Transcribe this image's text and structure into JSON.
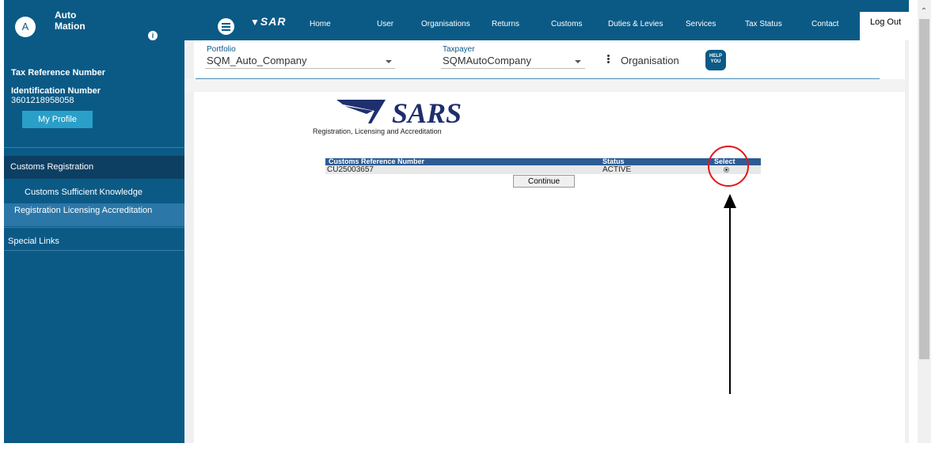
{
  "user": {
    "initial": "A",
    "first_name": "Auto",
    "last_name": "Mation",
    "info_icon": "info-icon"
  },
  "sidebar": {
    "tax_reference_label": "Tax Reference Number",
    "identification_label": "Identification Number",
    "identification_value": "3601218958058",
    "profile_button": "My Profile",
    "items": [
      {
        "label": "Customs Registration"
      },
      {
        "label": "Customs Sufficient Knowledge"
      },
      {
        "label": "Registration Licensing Accreditation"
      },
      {
        "label": "Special Links"
      }
    ]
  },
  "topnav": {
    "logo_text": "SAR",
    "links": [
      "Home",
      "User",
      "Organisations",
      "Returns",
      "Customs",
      "Duties & Levies",
      "Services",
      "Tax Status",
      "Contact"
    ],
    "logout": "Log Out"
  },
  "selectors": {
    "portfolio_label": "Portfolio",
    "portfolio_value": "SQM_Auto_Company",
    "taxpayer_label": "Taxpayer",
    "taxpayer_value": "SQMAutoCompany",
    "organisation_label": "Organisation",
    "help_icon_text": "HELP YOU"
  },
  "main": {
    "logo_text": "SARS",
    "subtitle": "Registration, Licensing and Accreditation",
    "table": {
      "headers": [
        "Customs Reference Number",
        "Status",
        "Select"
      ],
      "rows": [
        {
          "reference": "CU25003657",
          "status": "ACTIVE",
          "selected": true
        }
      ]
    },
    "continue_button": "Continue"
  },
  "colors": {
    "brand": "#0b5a86",
    "nav_dark": "#0d3f63",
    "highlight": "#2b77a8",
    "annotation": "#e01818"
  }
}
